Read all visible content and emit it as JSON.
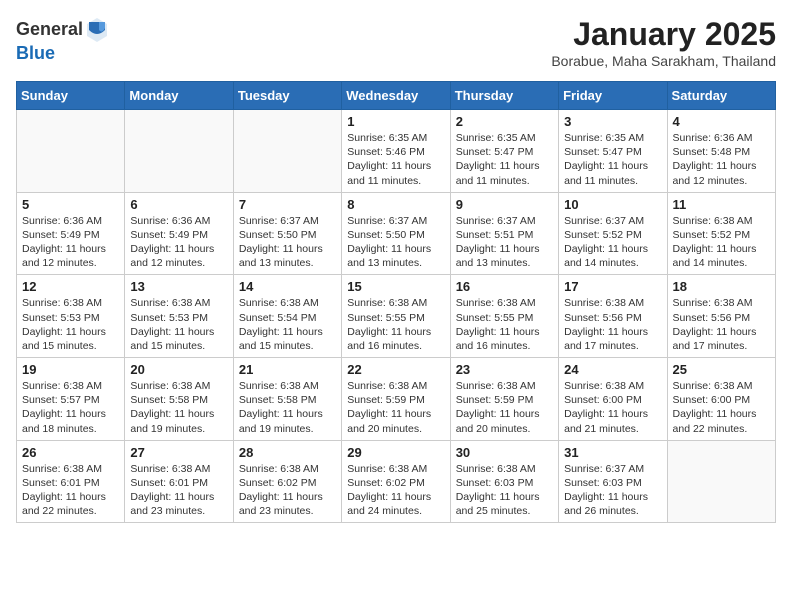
{
  "logo": {
    "general": "General",
    "blue": "Blue"
  },
  "title": "January 2025",
  "subtitle": "Borabue, Maha Sarakham, Thailand",
  "days_header": [
    "Sunday",
    "Monday",
    "Tuesday",
    "Wednesday",
    "Thursday",
    "Friday",
    "Saturday"
  ],
  "weeks": [
    [
      {
        "day": "",
        "sunrise": "",
        "sunset": "",
        "daylight": ""
      },
      {
        "day": "",
        "sunrise": "",
        "sunset": "",
        "daylight": ""
      },
      {
        "day": "",
        "sunrise": "",
        "sunset": "",
        "daylight": ""
      },
      {
        "day": "1",
        "sunrise": "Sunrise: 6:35 AM",
        "sunset": "Sunset: 5:46 PM",
        "daylight": "Daylight: 11 hours and 11 minutes."
      },
      {
        "day": "2",
        "sunrise": "Sunrise: 6:35 AM",
        "sunset": "Sunset: 5:47 PM",
        "daylight": "Daylight: 11 hours and 11 minutes."
      },
      {
        "day": "3",
        "sunrise": "Sunrise: 6:35 AM",
        "sunset": "Sunset: 5:47 PM",
        "daylight": "Daylight: 11 hours and 11 minutes."
      },
      {
        "day": "4",
        "sunrise": "Sunrise: 6:36 AM",
        "sunset": "Sunset: 5:48 PM",
        "daylight": "Daylight: 11 hours and 12 minutes."
      }
    ],
    [
      {
        "day": "5",
        "sunrise": "Sunrise: 6:36 AM",
        "sunset": "Sunset: 5:49 PM",
        "daylight": "Daylight: 11 hours and 12 minutes."
      },
      {
        "day": "6",
        "sunrise": "Sunrise: 6:36 AM",
        "sunset": "Sunset: 5:49 PM",
        "daylight": "Daylight: 11 hours and 12 minutes."
      },
      {
        "day": "7",
        "sunrise": "Sunrise: 6:37 AM",
        "sunset": "Sunset: 5:50 PM",
        "daylight": "Daylight: 11 hours and 13 minutes."
      },
      {
        "day": "8",
        "sunrise": "Sunrise: 6:37 AM",
        "sunset": "Sunset: 5:50 PM",
        "daylight": "Daylight: 11 hours and 13 minutes."
      },
      {
        "day": "9",
        "sunrise": "Sunrise: 6:37 AM",
        "sunset": "Sunset: 5:51 PM",
        "daylight": "Daylight: 11 hours and 13 minutes."
      },
      {
        "day": "10",
        "sunrise": "Sunrise: 6:37 AM",
        "sunset": "Sunset: 5:52 PM",
        "daylight": "Daylight: 11 hours and 14 minutes."
      },
      {
        "day": "11",
        "sunrise": "Sunrise: 6:38 AM",
        "sunset": "Sunset: 5:52 PM",
        "daylight": "Daylight: 11 hours and 14 minutes."
      }
    ],
    [
      {
        "day": "12",
        "sunrise": "Sunrise: 6:38 AM",
        "sunset": "Sunset: 5:53 PM",
        "daylight": "Daylight: 11 hours and 15 minutes."
      },
      {
        "day": "13",
        "sunrise": "Sunrise: 6:38 AM",
        "sunset": "Sunset: 5:53 PM",
        "daylight": "Daylight: 11 hours and 15 minutes."
      },
      {
        "day": "14",
        "sunrise": "Sunrise: 6:38 AM",
        "sunset": "Sunset: 5:54 PM",
        "daylight": "Daylight: 11 hours and 15 minutes."
      },
      {
        "day": "15",
        "sunrise": "Sunrise: 6:38 AM",
        "sunset": "Sunset: 5:55 PM",
        "daylight": "Daylight: 11 hours and 16 minutes."
      },
      {
        "day": "16",
        "sunrise": "Sunrise: 6:38 AM",
        "sunset": "Sunset: 5:55 PM",
        "daylight": "Daylight: 11 hours and 16 minutes."
      },
      {
        "day": "17",
        "sunrise": "Sunrise: 6:38 AM",
        "sunset": "Sunset: 5:56 PM",
        "daylight": "Daylight: 11 hours and 17 minutes."
      },
      {
        "day": "18",
        "sunrise": "Sunrise: 6:38 AM",
        "sunset": "Sunset: 5:56 PM",
        "daylight": "Daylight: 11 hours and 17 minutes."
      }
    ],
    [
      {
        "day": "19",
        "sunrise": "Sunrise: 6:38 AM",
        "sunset": "Sunset: 5:57 PM",
        "daylight": "Daylight: 11 hours and 18 minutes."
      },
      {
        "day": "20",
        "sunrise": "Sunrise: 6:38 AM",
        "sunset": "Sunset: 5:58 PM",
        "daylight": "Daylight: 11 hours and 19 minutes."
      },
      {
        "day": "21",
        "sunrise": "Sunrise: 6:38 AM",
        "sunset": "Sunset: 5:58 PM",
        "daylight": "Daylight: 11 hours and 19 minutes."
      },
      {
        "day": "22",
        "sunrise": "Sunrise: 6:38 AM",
        "sunset": "Sunset: 5:59 PM",
        "daylight": "Daylight: 11 hours and 20 minutes."
      },
      {
        "day": "23",
        "sunrise": "Sunrise: 6:38 AM",
        "sunset": "Sunset: 5:59 PM",
        "daylight": "Daylight: 11 hours and 20 minutes."
      },
      {
        "day": "24",
        "sunrise": "Sunrise: 6:38 AM",
        "sunset": "Sunset: 6:00 PM",
        "daylight": "Daylight: 11 hours and 21 minutes."
      },
      {
        "day": "25",
        "sunrise": "Sunrise: 6:38 AM",
        "sunset": "Sunset: 6:00 PM",
        "daylight": "Daylight: 11 hours and 22 minutes."
      }
    ],
    [
      {
        "day": "26",
        "sunrise": "Sunrise: 6:38 AM",
        "sunset": "Sunset: 6:01 PM",
        "daylight": "Daylight: 11 hours and 22 minutes."
      },
      {
        "day": "27",
        "sunrise": "Sunrise: 6:38 AM",
        "sunset": "Sunset: 6:01 PM",
        "daylight": "Daylight: 11 hours and 23 minutes."
      },
      {
        "day": "28",
        "sunrise": "Sunrise: 6:38 AM",
        "sunset": "Sunset: 6:02 PM",
        "daylight": "Daylight: 11 hours and 23 minutes."
      },
      {
        "day": "29",
        "sunrise": "Sunrise: 6:38 AM",
        "sunset": "Sunset: 6:02 PM",
        "daylight": "Daylight: 11 hours and 24 minutes."
      },
      {
        "day": "30",
        "sunrise": "Sunrise: 6:38 AM",
        "sunset": "Sunset: 6:03 PM",
        "daylight": "Daylight: 11 hours and 25 minutes."
      },
      {
        "day": "31",
        "sunrise": "Sunrise: 6:37 AM",
        "sunset": "Sunset: 6:03 PM",
        "daylight": "Daylight: 11 hours and 26 minutes."
      },
      {
        "day": "",
        "sunrise": "",
        "sunset": "",
        "daylight": ""
      }
    ]
  ]
}
